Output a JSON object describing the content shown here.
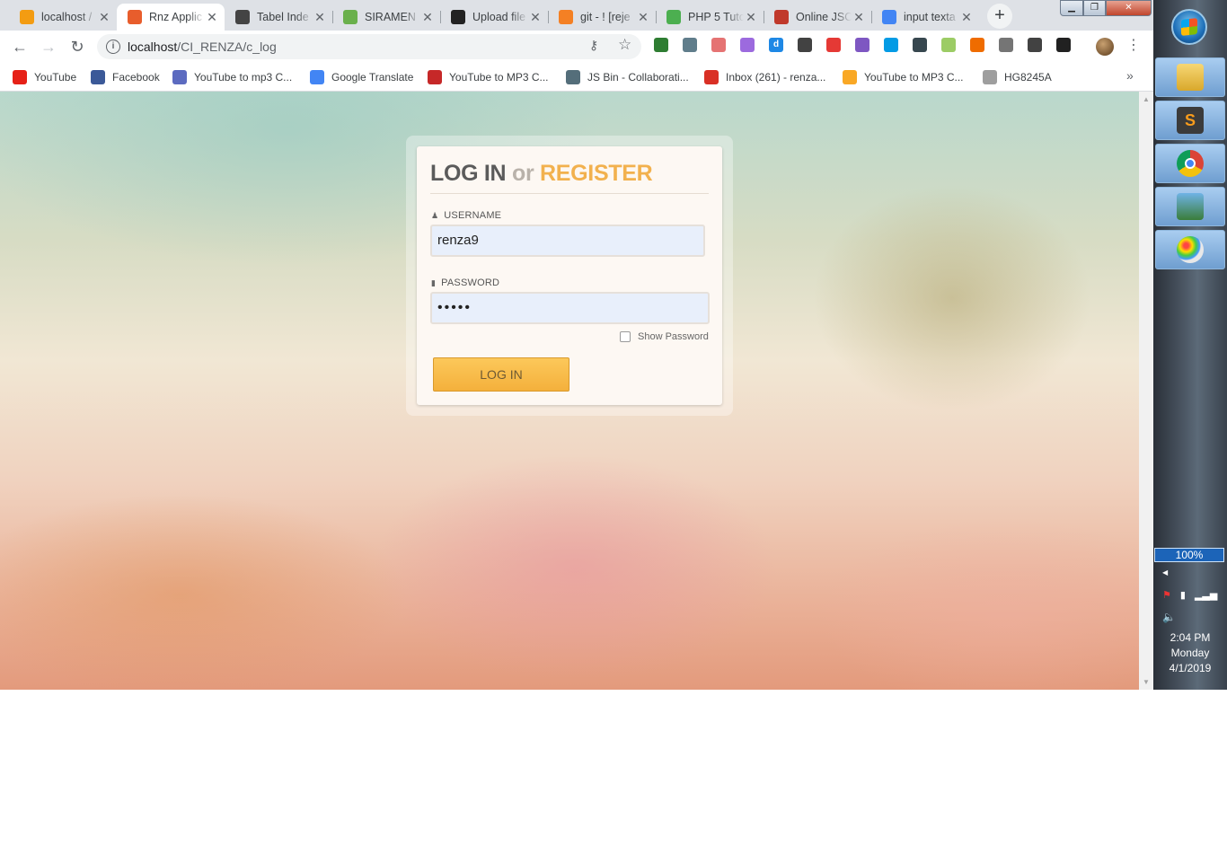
{
  "tabs": [
    {
      "title": "localhost /",
      "icon": "phpmyadmin-icon",
      "color": "#f39c12"
    },
    {
      "title": "Rnz Applic",
      "icon": "codeigniter-icon",
      "color": "#e85d2c",
      "active": true
    },
    {
      "title": "Tabel Inde",
      "icon": "tabel-icon",
      "color": "#444444"
    },
    {
      "title": "SIRAMEN",
      "icon": "siramen-icon",
      "color": "#6ab04c"
    },
    {
      "title": "Upload file",
      "icon": "github-icon",
      "color": "#222222"
    },
    {
      "title": "git - ! [reje",
      "icon": "stackoverflow-icon",
      "color": "#f48024"
    },
    {
      "title": "PHP 5 Tuto",
      "icon": "w3schools-icon",
      "color": "#4caf50"
    },
    {
      "title": "Online JSO",
      "icon": "jsonviewer-icon",
      "color": "#c0392b"
    },
    {
      "title": "input texta",
      "icon": "google-icon",
      "color": "#4285f4"
    }
  ],
  "toolbar": {
    "url_host": "localhost",
    "url_path": "/CI_RENZA/c_log"
  },
  "extensions": [
    {
      "name": "ext-globe-icon",
      "color": "#2e7d32"
    },
    {
      "name": "ext-recycle-icon",
      "color": "#607d8b"
    },
    {
      "name": "ext-calendar-icon",
      "color": "#e57373"
    },
    {
      "name": "ext-gem-icon",
      "color": "#9c6ade"
    },
    {
      "name": "ext-d-icon",
      "color": "#1e88e5",
      "glyph": "d"
    },
    {
      "name": "ext-bookmark-icon",
      "color": "#424242"
    },
    {
      "name": "ext-opera-icon",
      "color": "#e53935"
    },
    {
      "name": "ext-wave-icon",
      "color": "#7e57c2"
    },
    {
      "name": "ext-square-icon",
      "color": "#039be5"
    },
    {
      "name": "ext-screen-icon",
      "color": "#37474f"
    },
    {
      "name": "ext-leaf-icon",
      "color": "#9ccc65"
    },
    {
      "name": "ext-download-icon",
      "color": "#ef6c00"
    },
    {
      "name": "ext-circle-icon",
      "color": "#757575"
    },
    {
      "name": "ext-arrow-down-icon",
      "color": "#424242"
    },
    {
      "name": "ext-chain-icon",
      "color": "#212121"
    }
  ],
  "bookmarks": [
    {
      "label": "YouTube",
      "icon": "youtube-icon",
      "color": "#e62117"
    },
    {
      "label": "Facebook",
      "icon": "facebook-icon",
      "color": "#3b5998"
    },
    {
      "label": "YouTube to mp3 C...",
      "icon": "ytmp3-icon",
      "color": "#5c6bc0"
    },
    {
      "label": "Google Translate",
      "icon": "translate-icon",
      "color": "#4285f4"
    },
    {
      "label": "YouTube to MP3 C...",
      "icon": "ytmp3-red-icon",
      "color": "#c62828"
    },
    {
      "label": "JS Bin - Collaborati...",
      "icon": "jsbin-icon",
      "color": "#546e7a"
    },
    {
      "label": "Inbox (261) - renza...",
      "icon": "gmail-icon",
      "color": "#d93025"
    },
    {
      "label": "YouTube to MP3 C...",
      "icon": "ytmp3-yellow-icon",
      "color": "#f9a825"
    },
    {
      "label": "HG8245A",
      "icon": "page-icon",
      "color": "#9e9e9e"
    }
  ],
  "login": {
    "title_login": "LOG IN",
    "title_or": "or",
    "title_register": "REGISTER",
    "username_label": "USERNAME",
    "username_value": "renza9",
    "password_label": "PASSWORD",
    "password_value": "•••••",
    "show_password_label": "Show Password",
    "submit_label": "LOG IN"
  },
  "taskbar": {
    "battery": "100%",
    "time": "2:04 PM",
    "day": "Monday",
    "date": "4/1/2019"
  }
}
